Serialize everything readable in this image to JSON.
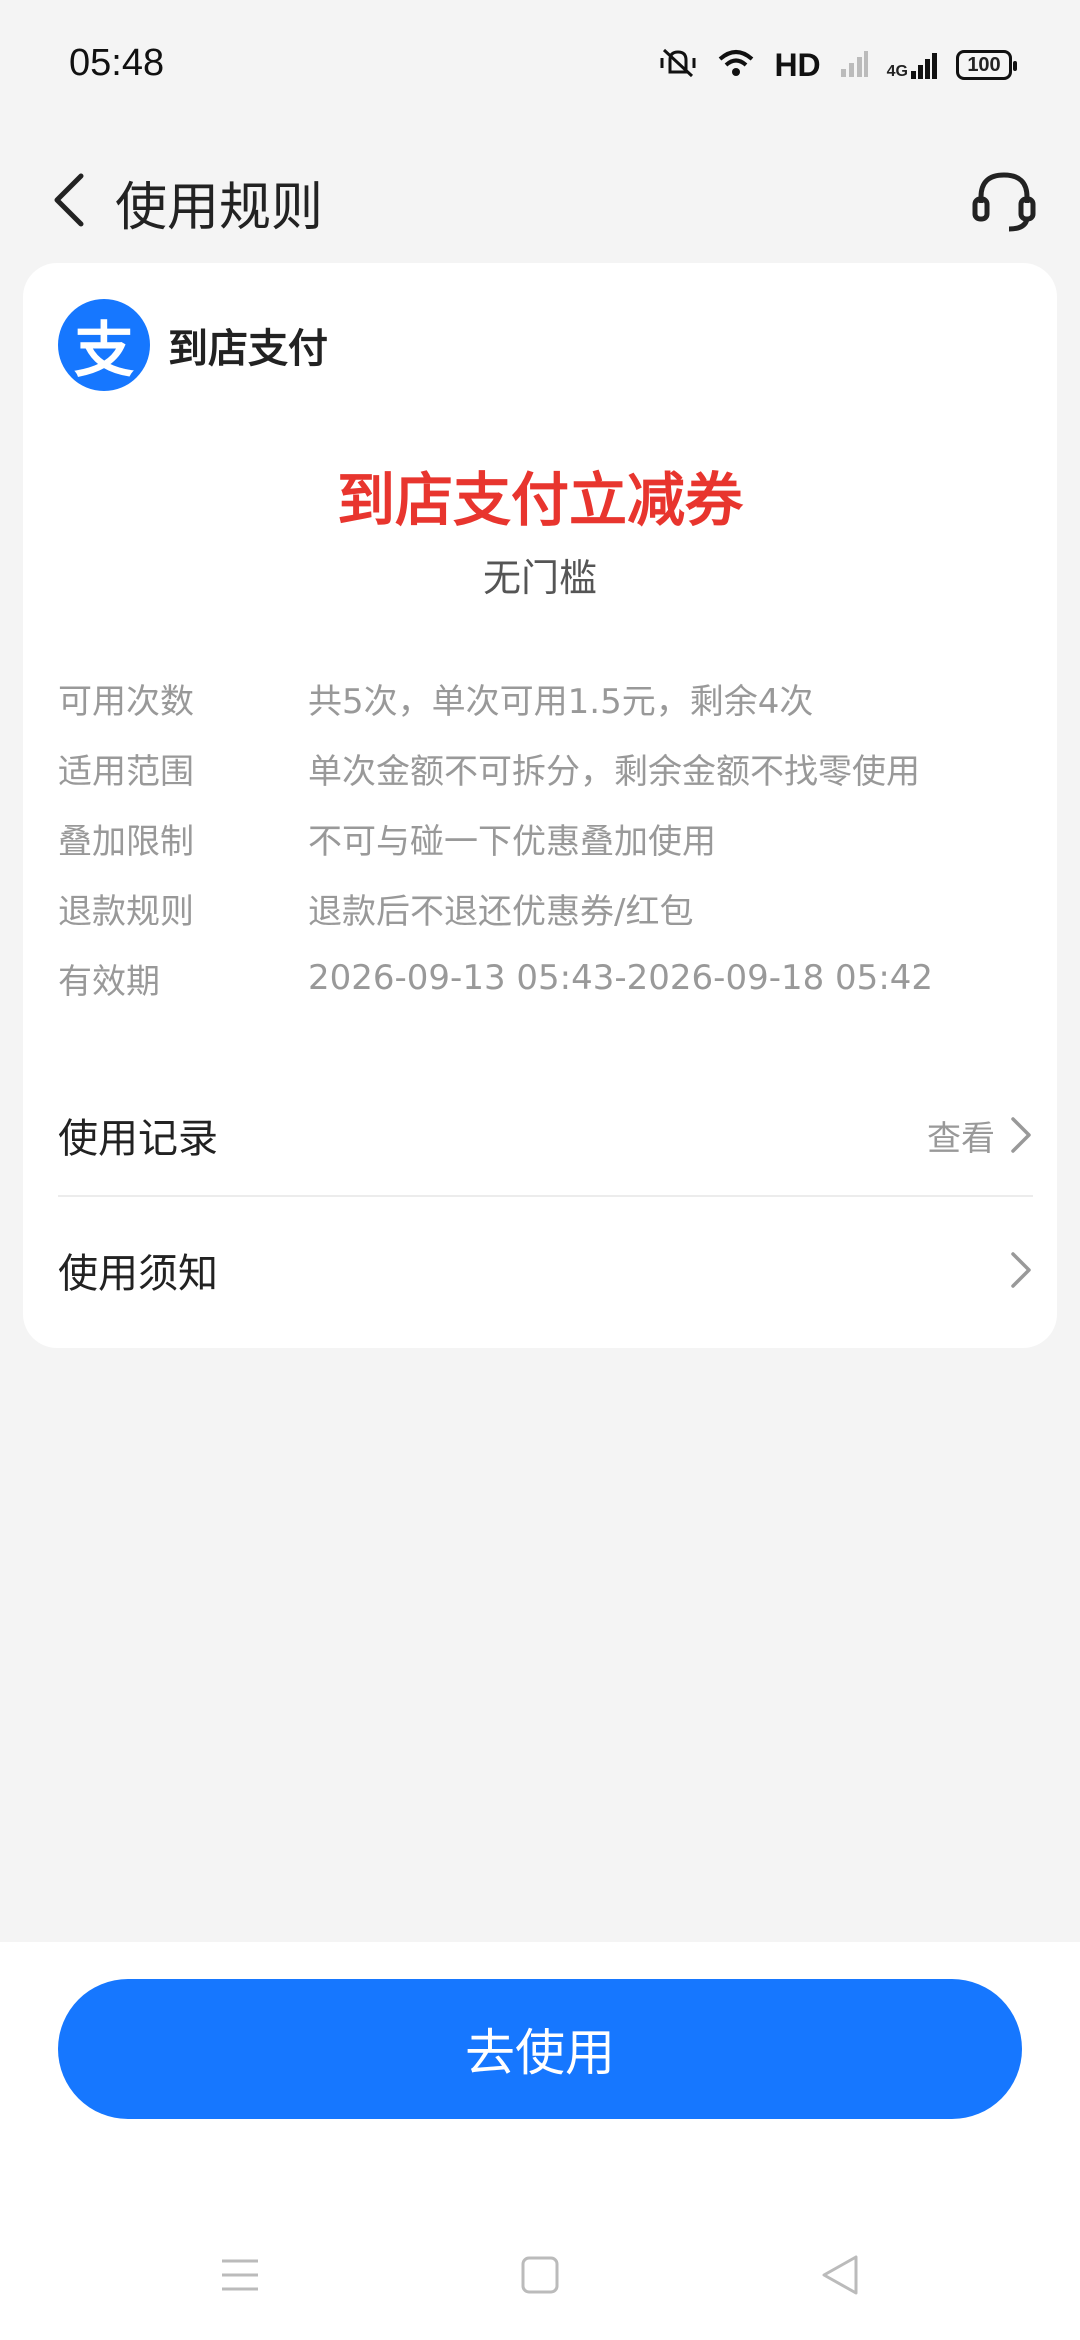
{
  "status_bar": {
    "time": "05:48",
    "network": "HD",
    "signal": "4G",
    "battery": "100"
  },
  "header": {
    "title": "使用规则",
    "back_icon": "back-arrow-icon",
    "service_icon": "headset-icon"
  },
  "card": {
    "brand_logo_char": "支",
    "brand_name": "到店支付",
    "coupon_title": "到店支付立减券",
    "coupon_subtitle": "无门槛",
    "rules": [
      {
        "label": "可用次数",
        "value": "共5次，单次可用1.5元，剩余4次"
      },
      {
        "label": "适用范围",
        "value": "单次金额不可拆分，剩余金额不找零使用"
      },
      {
        "label": "叠加限制",
        "value": "不可与碰一下优惠叠加使用"
      },
      {
        "label": "退款规则",
        "value": "退款后不退还优惠券/红包"
      },
      {
        "label": "有效期",
        "value": "2026-09-13 05:43-2026-09-18 05:42"
      }
    ],
    "records": {
      "label": "使用记录",
      "action": "查看"
    },
    "notes": {
      "label": "使用须知"
    }
  },
  "bottom": {
    "use_button": "去使用"
  },
  "colors": {
    "accent": "#1677ff",
    "title_red": "#e8352e"
  }
}
